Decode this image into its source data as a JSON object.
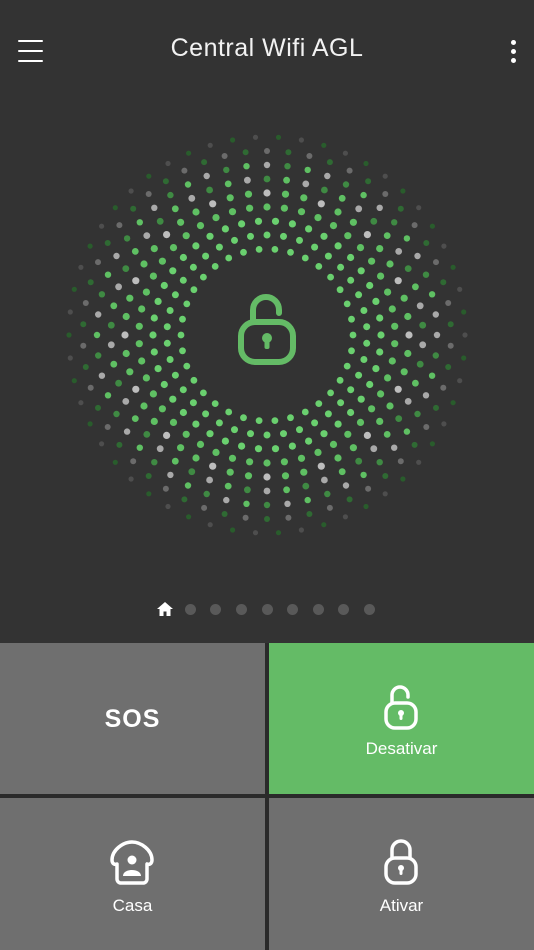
{
  "app": {
    "title": "Central Wifi AGL"
  },
  "header": {
    "menu_icon": "hamburger-menu-icon",
    "more_icon": "vertical-dots-icon"
  },
  "status": {
    "state_icon": "unlocked-padlock-icon",
    "accent_color": "#64bb66"
  },
  "pager": {
    "home_icon": "home-icon",
    "dot_count": 8,
    "active_index": 0
  },
  "actions": {
    "sos_label": "SOS",
    "disarm_label": "Desativar",
    "disarm_icon": "unlocked-padlock-icon",
    "home_label": "Casa",
    "home_icon": "house-person-icon",
    "arm_label": "Ativar",
    "arm_icon": "locked-padlock-icon"
  },
  "colors": {
    "background": "#333333",
    "tile": "#6f6f6f",
    "tile_active": "#64bb66"
  }
}
